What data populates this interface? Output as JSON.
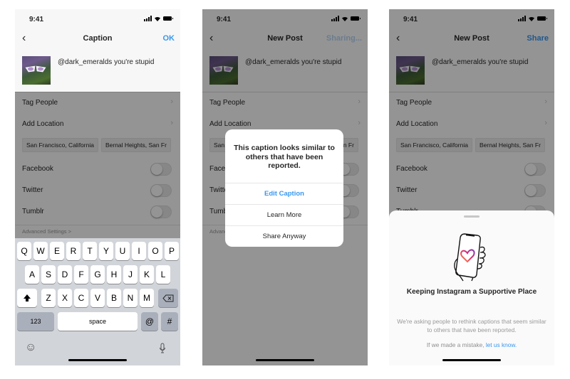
{
  "screens": [
    {
      "status_time": "9:41",
      "nav": {
        "back_icon": "chevron-left",
        "title": "Caption",
        "action": "OK"
      },
      "caption": "@dark_emeralds you're stupid",
      "settings": {
        "tag_people": "Tag People",
        "add_location": "Add Location",
        "location_chips": [
          "San Francisco, California",
          "Bernal Heights, San Fr"
        ],
        "toggles": [
          {
            "label": "Facebook",
            "on": false
          },
          {
            "label": "Twitter",
            "on": false
          },
          {
            "label": "Tumblr",
            "on": false
          }
        ],
        "advanced": "Advanced Settings >"
      },
      "keyboard": {
        "row1": [
          "Q",
          "W",
          "E",
          "R",
          "T",
          "Y",
          "U",
          "I",
          "O",
          "P"
        ],
        "row2": [
          "A",
          "S",
          "D",
          "F",
          "G",
          "H",
          "J",
          "K",
          "L"
        ],
        "row3": [
          "Z",
          "X",
          "C",
          "V",
          "B",
          "N",
          "M"
        ],
        "shift_icon": "shift-arrow",
        "delete_icon": "backspace",
        "numbers": "123",
        "space": "space",
        "at": "@",
        "hash": "#",
        "emoji_icon": "emoji",
        "mic_icon": "microphone"
      }
    },
    {
      "status_time": "9:41",
      "nav": {
        "back_icon": "chevron-left",
        "title": "New Post",
        "action": "Sharing..."
      },
      "caption": "@dark_emeralds you're stupid",
      "settings": {
        "tag_people": "Tag People",
        "add_location": "Add Location",
        "location_chips": [
          "San Francisco, California",
          "Bernal Heights, San Fr"
        ],
        "toggles": [
          {
            "label": "Facebook",
            "on": false
          },
          {
            "label": "Twitter",
            "on": false
          },
          {
            "label": "Tumblr",
            "on": false
          }
        ],
        "advanced": "Advanced Settings >"
      },
      "alert": {
        "title": "This caption looks similar to others that have been reported.",
        "buttons": [
          "Edit Caption",
          "Learn More",
          "Share Anyway"
        ]
      }
    },
    {
      "status_time": "9:41",
      "nav": {
        "back_icon": "chevron-left",
        "title": "New Post",
        "action": "Share"
      },
      "caption": "@dark_emeralds you're stupid",
      "settings": {
        "tag_people": "Tag People",
        "add_location": "Add Location",
        "location_chips": [
          "San Francisco, California",
          "Bernal Heights, San Fr"
        ],
        "toggles": [
          {
            "label": "Facebook",
            "on": false
          },
          {
            "label": "Twitter",
            "on": false
          },
          {
            "label": "Tumblr",
            "on": false
          }
        ]
      },
      "sheet": {
        "illustration": "hand-holding-phone-with-heart",
        "title": "Keeping Instagram a Supportive Place",
        "body": "We're asking people to rethink captions that seem similar to others that have been reported.",
        "footer_prefix": "If we made a mistake, ",
        "footer_link": "let us know."
      }
    }
  ],
  "colors": {
    "accent_blue": "#3897f0",
    "keyboard_bg": "#d1d4d9",
    "dim_overlay": "rgba(0,0,0,0.42)"
  }
}
